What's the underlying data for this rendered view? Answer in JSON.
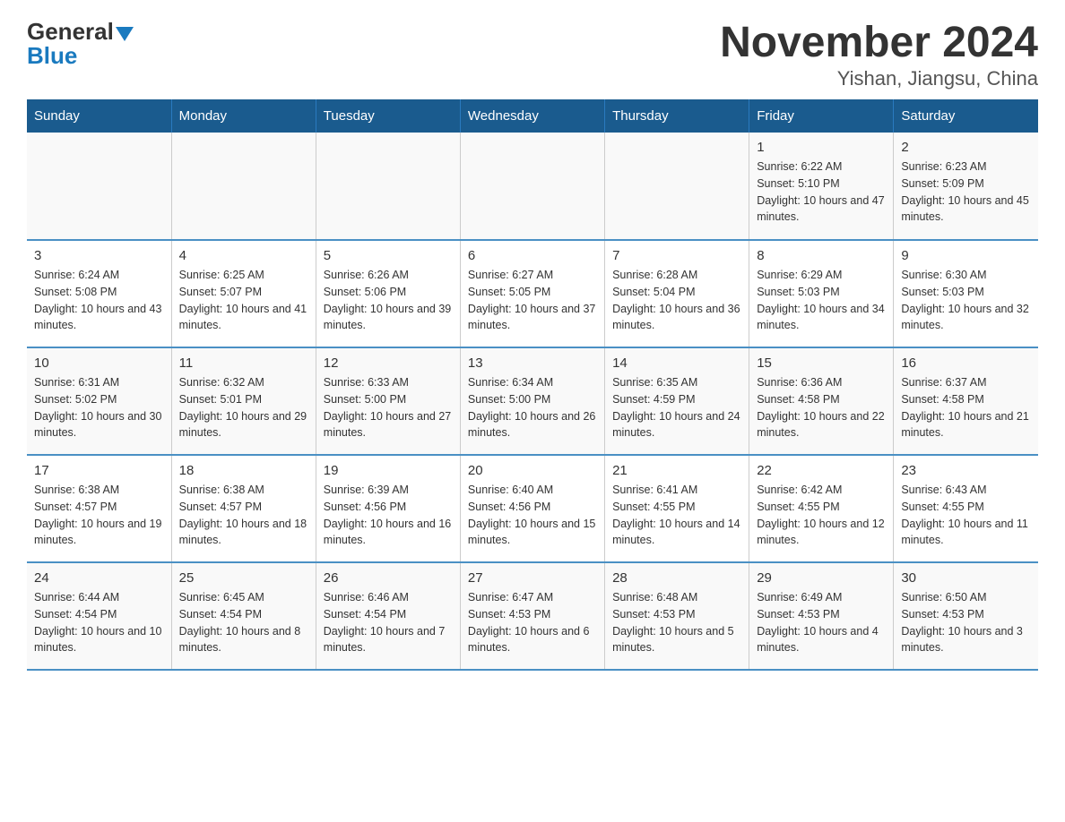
{
  "header": {
    "logo_general": "General",
    "logo_blue": "Blue",
    "title": "November 2024",
    "subtitle": "Yishan, Jiangsu, China"
  },
  "days_of_week": [
    "Sunday",
    "Monday",
    "Tuesday",
    "Wednesday",
    "Thursday",
    "Friday",
    "Saturday"
  ],
  "weeks": [
    [
      {
        "day": "",
        "info": ""
      },
      {
        "day": "",
        "info": ""
      },
      {
        "day": "",
        "info": ""
      },
      {
        "day": "",
        "info": ""
      },
      {
        "day": "",
        "info": ""
      },
      {
        "day": "1",
        "info": "Sunrise: 6:22 AM\nSunset: 5:10 PM\nDaylight: 10 hours and 47 minutes."
      },
      {
        "day": "2",
        "info": "Sunrise: 6:23 AM\nSunset: 5:09 PM\nDaylight: 10 hours and 45 minutes."
      }
    ],
    [
      {
        "day": "3",
        "info": "Sunrise: 6:24 AM\nSunset: 5:08 PM\nDaylight: 10 hours and 43 minutes."
      },
      {
        "day": "4",
        "info": "Sunrise: 6:25 AM\nSunset: 5:07 PM\nDaylight: 10 hours and 41 minutes."
      },
      {
        "day": "5",
        "info": "Sunrise: 6:26 AM\nSunset: 5:06 PM\nDaylight: 10 hours and 39 minutes."
      },
      {
        "day": "6",
        "info": "Sunrise: 6:27 AM\nSunset: 5:05 PM\nDaylight: 10 hours and 37 minutes."
      },
      {
        "day": "7",
        "info": "Sunrise: 6:28 AM\nSunset: 5:04 PM\nDaylight: 10 hours and 36 minutes."
      },
      {
        "day": "8",
        "info": "Sunrise: 6:29 AM\nSunset: 5:03 PM\nDaylight: 10 hours and 34 minutes."
      },
      {
        "day": "9",
        "info": "Sunrise: 6:30 AM\nSunset: 5:03 PM\nDaylight: 10 hours and 32 minutes."
      }
    ],
    [
      {
        "day": "10",
        "info": "Sunrise: 6:31 AM\nSunset: 5:02 PM\nDaylight: 10 hours and 30 minutes."
      },
      {
        "day": "11",
        "info": "Sunrise: 6:32 AM\nSunset: 5:01 PM\nDaylight: 10 hours and 29 minutes."
      },
      {
        "day": "12",
        "info": "Sunrise: 6:33 AM\nSunset: 5:00 PM\nDaylight: 10 hours and 27 minutes."
      },
      {
        "day": "13",
        "info": "Sunrise: 6:34 AM\nSunset: 5:00 PM\nDaylight: 10 hours and 26 minutes."
      },
      {
        "day": "14",
        "info": "Sunrise: 6:35 AM\nSunset: 4:59 PM\nDaylight: 10 hours and 24 minutes."
      },
      {
        "day": "15",
        "info": "Sunrise: 6:36 AM\nSunset: 4:58 PM\nDaylight: 10 hours and 22 minutes."
      },
      {
        "day": "16",
        "info": "Sunrise: 6:37 AM\nSunset: 4:58 PM\nDaylight: 10 hours and 21 minutes."
      }
    ],
    [
      {
        "day": "17",
        "info": "Sunrise: 6:38 AM\nSunset: 4:57 PM\nDaylight: 10 hours and 19 minutes."
      },
      {
        "day": "18",
        "info": "Sunrise: 6:38 AM\nSunset: 4:57 PM\nDaylight: 10 hours and 18 minutes."
      },
      {
        "day": "19",
        "info": "Sunrise: 6:39 AM\nSunset: 4:56 PM\nDaylight: 10 hours and 16 minutes."
      },
      {
        "day": "20",
        "info": "Sunrise: 6:40 AM\nSunset: 4:56 PM\nDaylight: 10 hours and 15 minutes."
      },
      {
        "day": "21",
        "info": "Sunrise: 6:41 AM\nSunset: 4:55 PM\nDaylight: 10 hours and 14 minutes."
      },
      {
        "day": "22",
        "info": "Sunrise: 6:42 AM\nSunset: 4:55 PM\nDaylight: 10 hours and 12 minutes."
      },
      {
        "day": "23",
        "info": "Sunrise: 6:43 AM\nSunset: 4:55 PM\nDaylight: 10 hours and 11 minutes."
      }
    ],
    [
      {
        "day": "24",
        "info": "Sunrise: 6:44 AM\nSunset: 4:54 PM\nDaylight: 10 hours and 10 minutes."
      },
      {
        "day": "25",
        "info": "Sunrise: 6:45 AM\nSunset: 4:54 PM\nDaylight: 10 hours and 8 minutes."
      },
      {
        "day": "26",
        "info": "Sunrise: 6:46 AM\nSunset: 4:54 PM\nDaylight: 10 hours and 7 minutes."
      },
      {
        "day": "27",
        "info": "Sunrise: 6:47 AM\nSunset: 4:53 PM\nDaylight: 10 hours and 6 minutes."
      },
      {
        "day": "28",
        "info": "Sunrise: 6:48 AM\nSunset: 4:53 PM\nDaylight: 10 hours and 5 minutes."
      },
      {
        "day": "29",
        "info": "Sunrise: 6:49 AM\nSunset: 4:53 PM\nDaylight: 10 hours and 4 minutes."
      },
      {
        "day": "30",
        "info": "Sunrise: 6:50 AM\nSunset: 4:53 PM\nDaylight: 10 hours and 3 minutes."
      }
    ]
  ]
}
